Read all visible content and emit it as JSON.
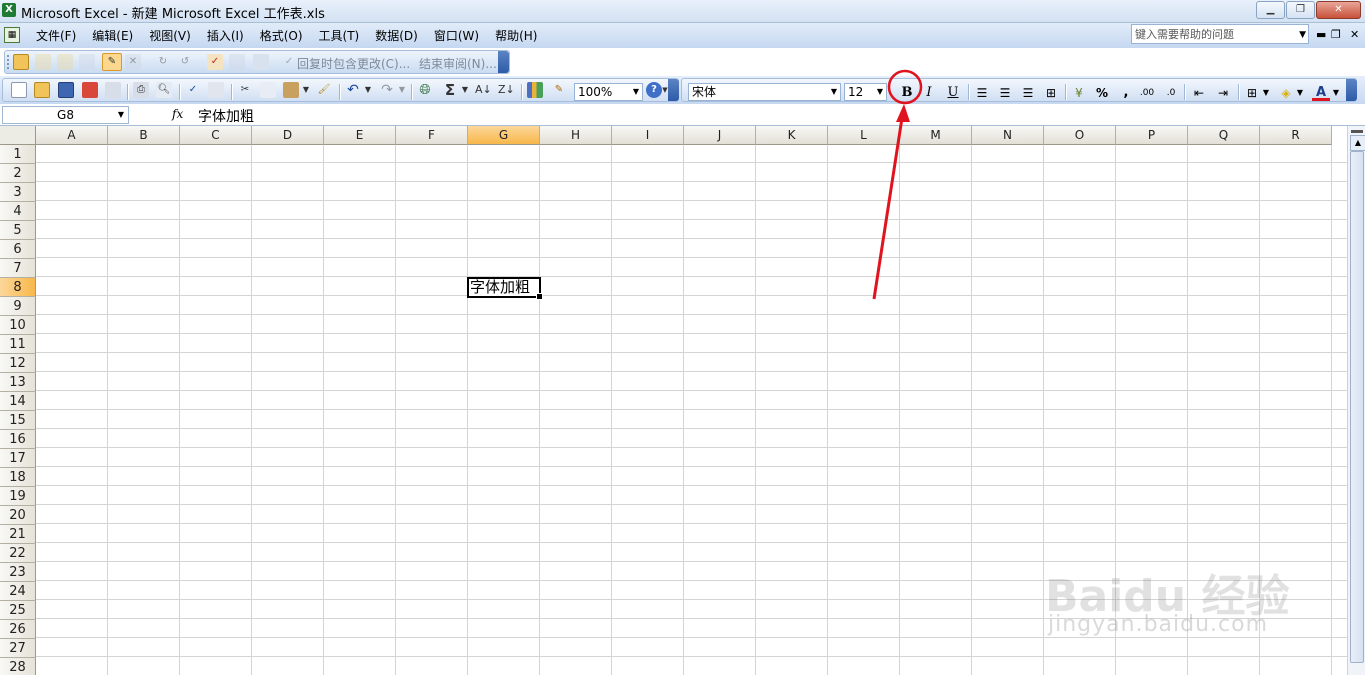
{
  "window": {
    "title": "Microsoft Excel - 新建 Microsoft Excel 工作表.xls"
  },
  "menubar": {
    "items": [
      "文件(F)",
      "编辑(E)",
      "视图(V)",
      "插入(I)",
      "格式(O)",
      "工具(T)",
      "数据(D)",
      "窗口(W)",
      "帮助(H)"
    ],
    "help_placeholder": "键入需要帮助的问题"
  },
  "reviewing": {
    "reply_label": "回复时包含更改(C)...",
    "end_review_label": "结束审阅(N)..."
  },
  "toolbar": {
    "zoom": "100%",
    "font_name": "宋体",
    "font_size": "12",
    "bold_label": "B",
    "italic_label": "I",
    "underline_label": "U",
    "percent_label": "%",
    "comma_label": ",",
    "font_color_label": "A"
  },
  "formula_bar": {
    "name_box": "G8",
    "fx_label": "fx",
    "content": "字体加粗"
  },
  "sheet": {
    "columns": [
      "A",
      "B",
      "C",
      "D",
      "E",
      "F",
      "G",
      "H",
      "I",
      "J",
      "K",
      "L",
      "M",
      "N",
      "O",
      "P",
      "Q",
      "R"
    ],
    "rows": [
      "1",
      "2",
      "3",
      "4",
      "5",
      "6",
      "7",
      "8",
      "9",
      "10",
      "11",
      "12",
      "13",
      "14",
      "15",
      "16",
      "17",
      "18",
      "19",
      "20",
      "21",
      "22",
      "23",
      "24",
      "25",
      "26",
      "27",
      "28"
    ],
    "selected_column": "G",
    "selected_row": "8",
    "active_cell_text": "字体加粗"
  },
  "colors": {
    "annotation": "#e0141e",
    "selected_header": "#f8b84a"
  },
  "watermark": {
    "brand": "Baidu 经验",
    "url": "jingyan.baidu.com"
  }
}
